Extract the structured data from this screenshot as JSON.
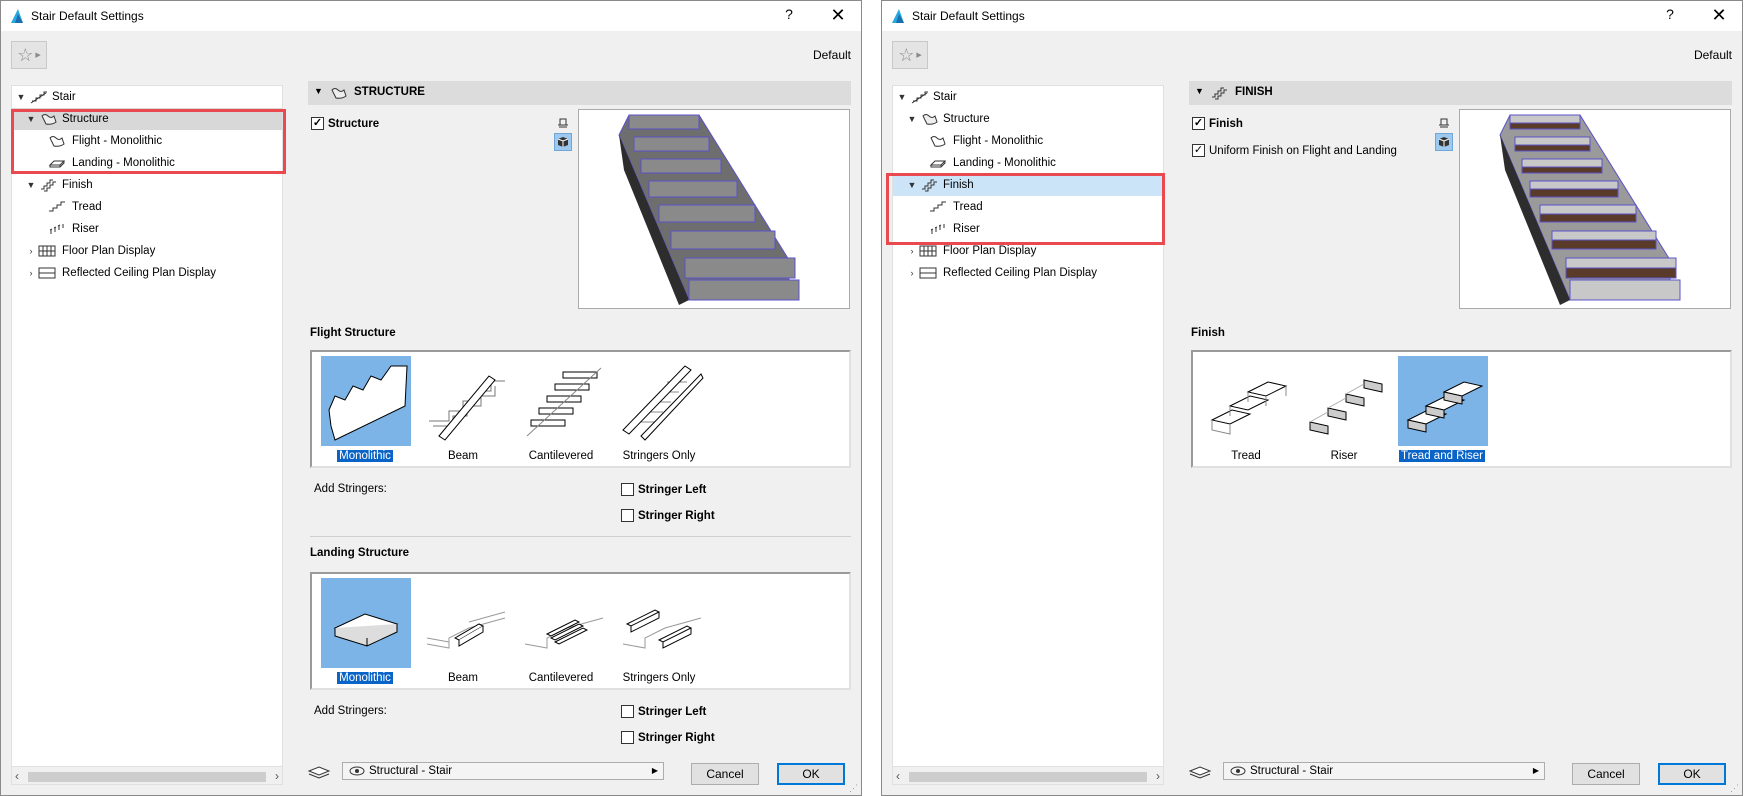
{
  "left": {
    "title": "Stair Default Settings",
    "help": "?",
    "close": "✕",
    "preset": "Default",
    "tree": {
      "stair": "Stair",
      "structure": "Structure",
      "flight": "Flight - Monolithic",
      "landing": "Landing - Monolithic",
      "finish": "Finish",
      "tread": "Tread",
      "riser": "Riser",
      "floor_plan": "Floor Plan Display",
      "rcp": "Reflected Ceiling Plan Display"
    },
    "section": "STRUCTURE",
    "structure_check": "Structure",
    "flight_header": "Flight Structure",
    "flight_options": [
      "Monolithic",
      "Beam",
      "Cantilevered",
      "Stringers Only"
    ],
    "add_stringers": "Add Stringers:",
    "stringer_left": "Stringer Left",
    "stringer_right": "Stringer Right",
    "landing_header": "Landing Structure",
    "landing_options": [
      "Monolithic",
      "Beam",
      "Cantilevered",
      "Stringers Only"
    ],
    "add_stringers2": "Add Stringers:",
    "stringer_left2": "Stringer Left",
    "stringer_right2": "Stringer Right",
    "layer": "Structural - Stair",
    "cancel": "Cancel",
    "ok": "OK"
  },
  "right": {
    "title": "Stair Default Settings",
    "help": "?",
    "close": "✕",
    "preset": "Default",
    "tree": {
      "stair": "Stair",
      "structure": "Structure",
      "flight": "Flight - Monolithic",
      "landing": "Landing - Monolithic",
      "finish": "Finish",
      "tread": "Tread",
      "riser": "Riser",
      "floor_plan": "Floor Plan Display",
      "rcp": "Reflected Ceiling Plan Display"
    },
    "section": "FINISH",
    "finish_check": "Finish",
    "uniform_check": "Uniform Finish on Flight and Landing",
    "finish_header": "Finish",
    "finish_options": [
      "Tread",
      "Riser",
      "Tread and Riser"
    ],
    "layer": "Structural - Stair",
    "cancel": "Cancel",
    "ok": "OK"
  },
  "colors": {
    "highlight": "#e84a50",
    "selection": "#0a64c8",
    "tile": "#7db4e8"
  }
}
